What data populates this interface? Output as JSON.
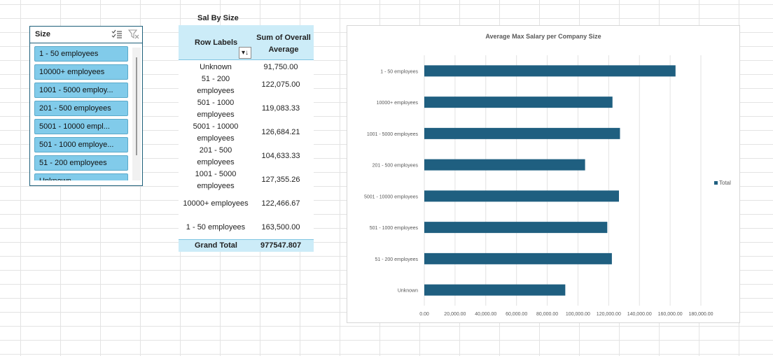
{
  "slicer": {
    "title": "Size",
    "items": [
      "1 - 50 employees",
      "10000+ employees",
      "1001 - 5000 employ...",
      "201 - 500 employees",
      "5001 - 10000 empl...",
      "501 - 1000 employe...",
      "51 - 200 employees",
      "Unknown"
    ]
  },
  "pivot": {
    "title": "Sal By Size",
    "header_labels": "Row Labels",
    "header_sum_line1": "Sum of Overall",
    "header_sum_line2": "Average",
    "sort_glyph": "▾↓",
    "rows": [
      {
        "l1": "Unknown",
        "l2": "",
        "value": "91,750.00"
      },
      {
        "l1": "51 - 200",
        "l2": "employees",
        "value": "122,075.00"
      },
      {
        "l1": "501 - 1000",
        "l2": "employees",
        "value": "119,083.33"
      },
      {
        "l1": "5001 - 10000",
        "l2": "employees",
        "value": "126,684.21"
      },
      {
        "l1": "201 - 500",
        "l2": "employees",
        "value": "104,633.33"
      },
      {
        "l1": "1001 - 5000",
        "l2": "employees",
        "value": "127,355.26"
      },
      {
        "l1": "10000+ employees",
        "l2": "",
        "value": "122,466.67"
      },
      {
        "l1": "1 - 50 employees",
        "l2": "",
        "value": "163,500.00"
      }
    ],
    "total_label": "Grand Total",
    "total_value": "977547.807"
  },
  "chart_data": {
    "type": "bar",
    "orientation": "horizontal",
    "title": "Average Max Salary per Company Size",
    "categories": [
      "1 - 50 employees",
      "10000+ employees",
      "1001 - 5000 employees",
      "201 - 500 employees",
      "5001 - 10000 employees",
      "501 - 1000 employees",
      "51 - 200 employees",
      "Unknown"
    ],
    "series": [
      {
        "name": "Total",
        "values": [
          163500,
          122466.67,
          127355.26,
          104633.33,
          126684.21,
          119083.33,
          122075,
          91750
        ]
      }
    ],
    "xlim": [
      0,
      180000
    ],
    "x_ticks": [
      "0.00",
      "20,000.00",
      "40,000.00",
      "60,000.00",
      "80,000.00",
      "100,000.00",
      "120,000.00",
      "140,000.00",
      "160,000.00",
      "180,000.00"
    ],
    "grid": true,
    "legend": "right",
    "color": "#1f5f80"
  }
}
